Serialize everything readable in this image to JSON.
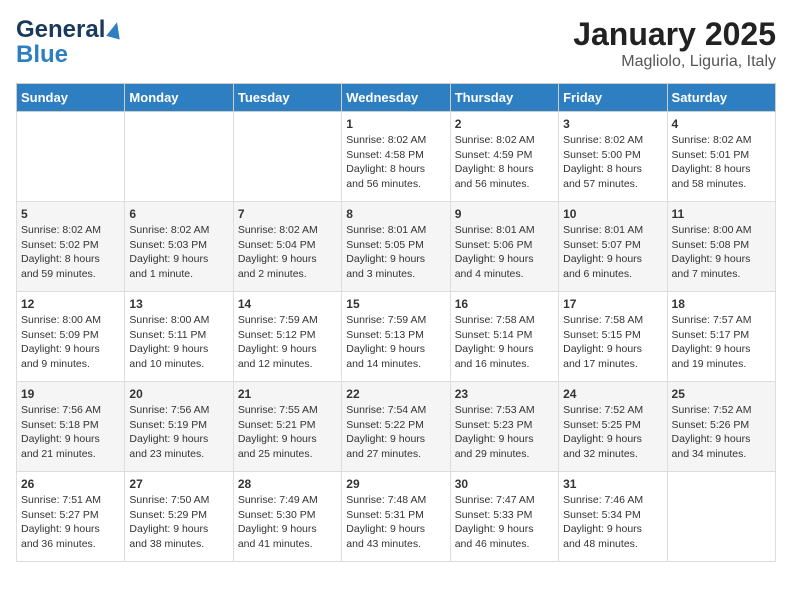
{
  "logo": {
    "line1": "General",
    "line2": "Blue"
  },
  "title": "January 2025",
  "subtitle": "Magliolo, Liguria, Italy",
  "headers": [
    "Sunday",
    "Monday",
    "Tuesday",
    "Wednesday",
    "Thursday",
    "Friday",
    "Saturday"
  ],
  "weeks": [
    [
      {
        "day": "",
        "info": ""
      },
      {
        "day": "",
        "info": ""
      },
      {
        "day": "",
        "info": ""
      },
      {
        "day": "1",
        "info": "Sunrise: 8:02 AM\nSunset: 4:58 PM\nDaylight: 8 hours\nand 56 minutes."
      },
      {
        "day": "2",
        "info": "Sunrise: 8:02 AM\nSunset: 4:59 PM\nDaylight: 8 hours\nand 56 minutes."
      },
      {
        "day": "3",
        "info": "Sunrise: 8:02 AM\nSunset: 5:00 PM\nDaylight: 8 hours\nand 57 minutes."
      },
      {
        "day": "4",
        "info": "Sunrise: 8:02 AM\nSunset: 5:01 PM\nDaylight: 8 hours\nand 58 minutes."
      }
    ],
    [
      {
        "day": "5",
        "info": "Sunrise: 8:02 AM\nSunset: 5:02 PM\nDaylight: 8 hours\nand 59 minutes."
      },
      {
        "day": "6",
        "info": "Sunrise: 8:02 AM\nSunset: 5:03 PM\nDaylight: 9 hours\nand 1 minute."
      },
      {
        "day": "7",
        "info": "Sunrise: 8:02 AM\nSunset: 5:04 PM\nDaylight: 9 hours\nand 2 minutes."
      },
      {
        "day": "8",
        "info": "Sunrise: 8:01 AM\nSunset: 5:05 PM\nDaylight: 9 hours\nand 3 minutes."
      },
      {
        "day": "9",
        "info": "Sunrise: 8:01 AM\nSunset: 5:06 PM\nDaylight: 9 hours\nand 4 minutes."
      },
      {
        "day": "10",
        "info": "Sunrise: 8:01 AM\nSunset: 5:07 PM\nDaylight: 9 hours\nand 6 minutes."
      },
      {
        "day": "11",
        "info": "Sunrise: 8:00 AM\nSunset: 5:08 PM\nDaylight: 9 hours\nand 7 minutes."
      }
    ],
    [
      {
        "day": "12",
        "info": "Sunrise: 8:00 AM\nSunset: 5:09 PM\nDaylight: 9 hours\nand 9 minutes."
      },
      {
        "day": "13",
        "info": "Sunrise: 8:00 AM\nSunset: 5:11 PM\nDaylight: 9 hours\nand 10 minutes."
      },
      {
        "day": "14",
        "info": "Sunrise: 7:59 AM\nSunset: 5:12 PM\nDaylight: 9 hours\nand 12 minutes."
      },
      {
        "day": "15",
        "info": "Sunrise: 7:59 AM\nSunset: 5:13 PM\nDaylight: 9 hours\nand 14 minutes."
      },
      {
        "day": "16",
        "info": "Sunrise: 7:58 AM\nSunset: 5:14 PM\nDaylight: 9 hours\nand 16 minutes."
      },
      {
        "day": "17",
        "info": "Sunrise: 7:58 AM\nSunset: 5:15 PM\nDaylight: 9 hours\nand 17 minutes."
      },
      {
        "day": "18",
        "info": "Sunrise: 7:57 AM\nSunset: 5:17 PM\nDaylight: 9 hours\nand 19 minutes."
      }
    ],
    [
      {
        "day": "19",
        "info": "Sunrise: 7:56 AM\nSunset: 5:18 PM\nDaylight: 9 hours\nand 21 minutes."
      },
      {
        "day": "20",
        "info": "Sunrise: 7:56 AM\nSunset: 5:19 PM\nDaylight: 9 hours\nand 23 minutes."
      },
      {
        "day": "21",
        "info": "Sunrise: 7:55 AM\nSunset: 5:21 PM\nDaylight: 9 hours\nand 25 minutes."
      },
      {
        "day": "22",
        "info": "Sunrise: 7:54 AM\nSunset: 5:22 PM\nDaylight: 9 hours\nand 27 minutes."
      },
      {
        "day": "23",
        "info": "Sunrise: 7:53 AM\nSunset: 5:23 PM\nDaylight: 9 hours\nand 29 minutes."
      },
      {
        "day": "24",
        "info": "Sunrise: 7:52 AM\nSunset: 5:25 PM\nDaylight: 9 hours\nand 32 minutes."
      },
      {
        "day": "25",
        "info": "Sunrise: 7:52 AM\nSunset: 5:26 PM\nDaylight: 9 hours\nand 34 minutes."
      }
    ],
    [
      {
        "day": "26",
        "info": "Sunrise: 7:51 AM\nSunset: 5:27 PM\nDaylight: 9 hours\nand 36 minutes."
      },
      {
        "day": "27",
        "info": "Sunrise: 7:50 AM\nSunset: 5:29 PM\nDaylight: 9 hours\nand 38 minutes."
      },
      {
        "day": "28",
        "info": "Sunrise: 7:49 AM\nSunset: 5:30 PM\nDaylight: 9 hours\nand 41 minutes."
      },
      {
        "day": "29",
        "info": "Sunrise: 7:48 AM\nSunset: 5:31 PM\nDaylight: 9 hours\nand 43 minutes."
      },
      {
        "day": "30",
        "info": "Sunrise: 7:47 AM\nSunset: 5:33 PM\nDaylight: 9 hours\nand 46 minutes."
      },
      {
        "day": "31",
        "info": "Sunrise: 7:46 AM\nSunset: 5:34 PM\nDaylight: 9 hours\nand 48 minutes."
      },
      {
        "day": "",
        "info": ""
      }
    ]
  ]
}
